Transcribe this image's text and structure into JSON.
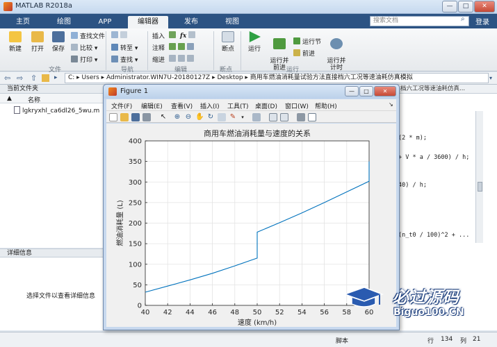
{
  "app": {
    "title": "MATLAB R2018a",
    "tabs": [
      "主页",
      "绘图",
      "APP",
      "编辑器",
      "发布",
      "视图"
    ],
    "active_tab": "编辑器",
    "search_placeholder": "搜索文档",
    "login_label": "登录"
  },
  "ribbon": {
    "file_group": {
      "new": "新建",
      "open": "打开",
      "save": "保存",
      "find_files": "查找文件",
      "compare": "比较",
      "print": "打印",
      "label": "文件"
    },
    "nav_group": {
      "goto": "转至",
      "find": "查找",
      "label": "导航"
    },
    "edit_group": {
      "insert": "插入",
      "comment": "注释",
      "indent": "缩进",
      "label": "编辑"
    },
    "breakpoint_group": {
      "breakpoints": "断点",
      "label": "断点"
    },
    "run_group": {
      "run": "运行",
      "run_advance": "运行并\n前进",
      "run_section": "运行节",
      "advance": "前进",
      "run_time": "运行并\n计时",
      "label": "运行"
    }
  },
  "address": {
    "path": "C: ▸ Users ▸ Administrator.WIN7U-20180127Z ▸ Desktop ▸ 商用车燃油消耗量试验方法直接档六工况等速油耗仿真模拟"
  },
  "current_folder": {
    "header": "当前文件夹",
    "col_name": "名称",
    "sort_glyph": "▲",
    "files": [
      "lgkryxhl_ca6dl26_5wu.m"
    ]
  },
  "details": {
    "header": "详细信息",
    "message": "选择文件以查看详细信息"
  },
  "editor": {
    "tab_text": "档六工况等速油耗仿真...",
    "lines": [
      {
        "row": 0,
        "text": "(2 * m);"
      },
      {
        "row": 1,
        "text": "+ V * a / 3600) / h;"
      },
      {
        "row": 2,
        "text": "40) / h;"
      },
      {
        "row": 3,
        "text": "(n_t0 / 100)^2 + ..."
      }
    ]
  },
  "statusbar": {
    "script": "脚本",
    "row_label": "行",
    "row": "134",
    "col_label": "列",
    "col": "21"
  },
  "figure": {
    "window_title": "Figure 1",
    "menu": [
      "文件(F)",
      "编辑(E)",
      "查看(V)",
      "插入(I)",
      "工具(T)",
      "桌面(D)",
      "窗口(W)",
      "帮助(H)"
    ]
  },
  "chart_data": {
    "type": "line",
    "title": "商用车燃油消耗量与速度的关系",
    "xlabel": "速度 (km/h)",
    "ylabel": "燃油消耗量 (L)",
    "xlim": [
      40,
      60
    ],
    "ylim": [
      0,
      400
    ],
    "xticks": [
      40,
      42,
      44,
      46,
      48,
      50,
      52,
      54,
      56,
      58,
      60
    ],
    "yticks": [
      0,
      50,
      100,
      150,
      200,
      250,
      300,
      350,
      400
    ],
    "grid": true,
    "color": "#0072BD",
    "series": [
      {
        "x": [
          40,
          42,
          44,
          46,
          48,
          50,
          50,
          52,
          54,
          56,
          58,
          60,
          60
        ],
        "y": [
          32,
          47,
          62,
          78,
          96,
          115,
          178,
          201,
          225,
          250,
          276,
          302,
          350
        ]
      }
    ]
  },
  "watermark": {
    "line1": "必过源码",
    "line2": "Biguo100.CN"
  }
}
